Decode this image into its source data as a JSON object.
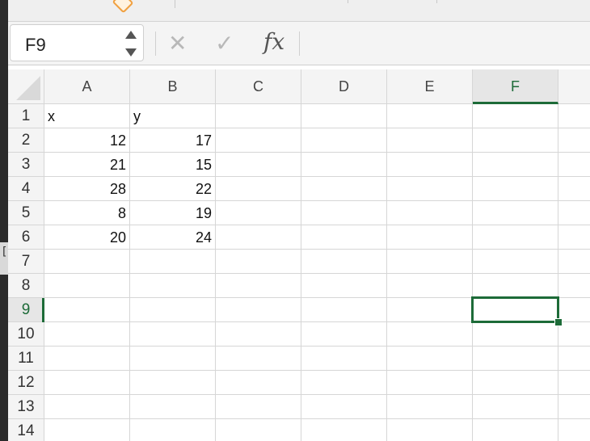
{
  "formula_bar": {
    "name_box_value": "F9",
    "cancel_icon": "close-icon",
    "enter_icon": "check-icon",
    "fx_label": "fx",
    "formula_value": ""
  },
  "sheet": {
    "columns": [
      "A",
      "B",
      "C",
      "D",
      "E",
      "F"
    ],
    "selected_column": "F",
    "rows": [
      "1",
      "2",
      "3",
      "4",
      "5",
      "6",
      "7",
      "8",
      "9",
      "10",
      "11",
      "12",
      "13",
      "14"
    ],
    "selected_row": "9",
    "cells": {
      "A1": "x",
      "B1": "y",
      "A2": "12",
      "B2": "17",
      "A3": "21",
      "B3": "15",
      "A4": "28",
      "B4": "22",
      "A5": "8",
      "B5": "19",
      "A6": "20",
      "B6": "24"
    },
    "active_cell": "F9",
    "accent_color": "#1d6b38"
  }
}
